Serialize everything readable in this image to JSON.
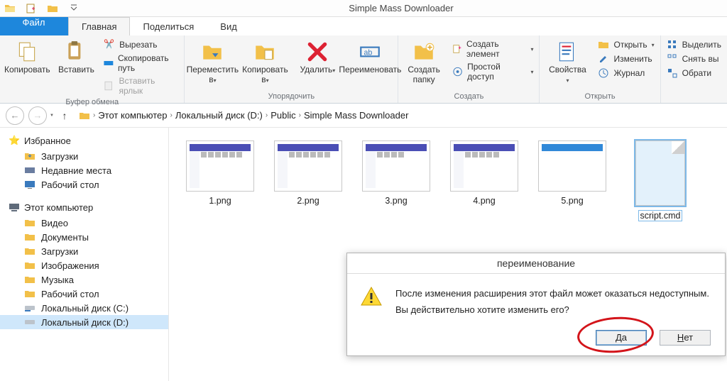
{
  "window": {
    "title": "Simple Mass Downloader"
  },
  "tabs": {
    "file": "Файл",
    "home": "Главная",
    "share": "Поделиться",
    "view": "Вид"
  },
  "ribbon": {
    "clipboard": {
      "label": "Буфер обмена",
      "copy": "Копировать",
      "paste": "Вставить",
      "cut": "Вырезать",
      "copy_path": "Скопировать путь",
      "paste_shortcut": "Вставить ярлык"
    },
    "organize": {
      "label": "Упорядочить",
      "move_to": "Переместить в",
      "copy_to": "Копировать в",
      "delete": "Удалить",
      "rename": "Переименовать"
    },
    "new": {
      "label": "Создать",
      "new_folder": "Создать папку",
      "new_item": "Создать элемент",
      "easy_access": "Простой доступ"
    },
    "open": {
      "label": "Открыть",
      "properties": "Свойства",
      "open": "Открыть",
      "edit": "Изменить",
      "history": "Журнал"
    },
    "select": {
      "label": "",
      "select_all": "Выделить",
      "select_none": "Снять вы",
      "invert": "Обрати"
    }
  },
  "breadcrumbs": [
    "Этот компьютер",
    "Локальный диск (D:)",
    "Public",
    "Simple Mass Downloader"
  ],
  "sidebar": {
    "favorites": {
      "title": "Избранное",
      "items": [
        "Загрузки",
        "Недавние места",
        "Рабочий стол"
      ]
    },
    "computer": {
      "title": "Этот компьютер",
      "items": [
        "Видео",
        "Документы",
        "Загрузки",
        "Изображения",
        "Музыка",
        "Рабочий стол",
        "Локальный диск (C:)",
        "Локальный диск (D:)"
      ]
    }
  },
  "files": {
    "items": [
      {
        "name": "1.png",
        "type": "thumb"
      },
      {
        "name": "2.png",
        "type": "thumb"
      },
      {
        "name": "3.png",
        "type": "thumb"
      },
      {
        "name": "4.png",
        "type": "thumb"
      },
      {
        "name": "5.png",
        "type": "thumb"
      },
      {
        "name": "script.cmd",
        "type": "doc",
        "selected": true
      }
    ]
  },
  "dialog": {
    "title": "переименование",
    "line1": "После изменения расширения этот файл может оказаться недоступным.",
    "line2": "Вы действительно хотите изменить его?",
    "yes": "Да",
    "yes_u": "Д",
    "no": "Нет",
    "no_u": "Н"
  }
}
